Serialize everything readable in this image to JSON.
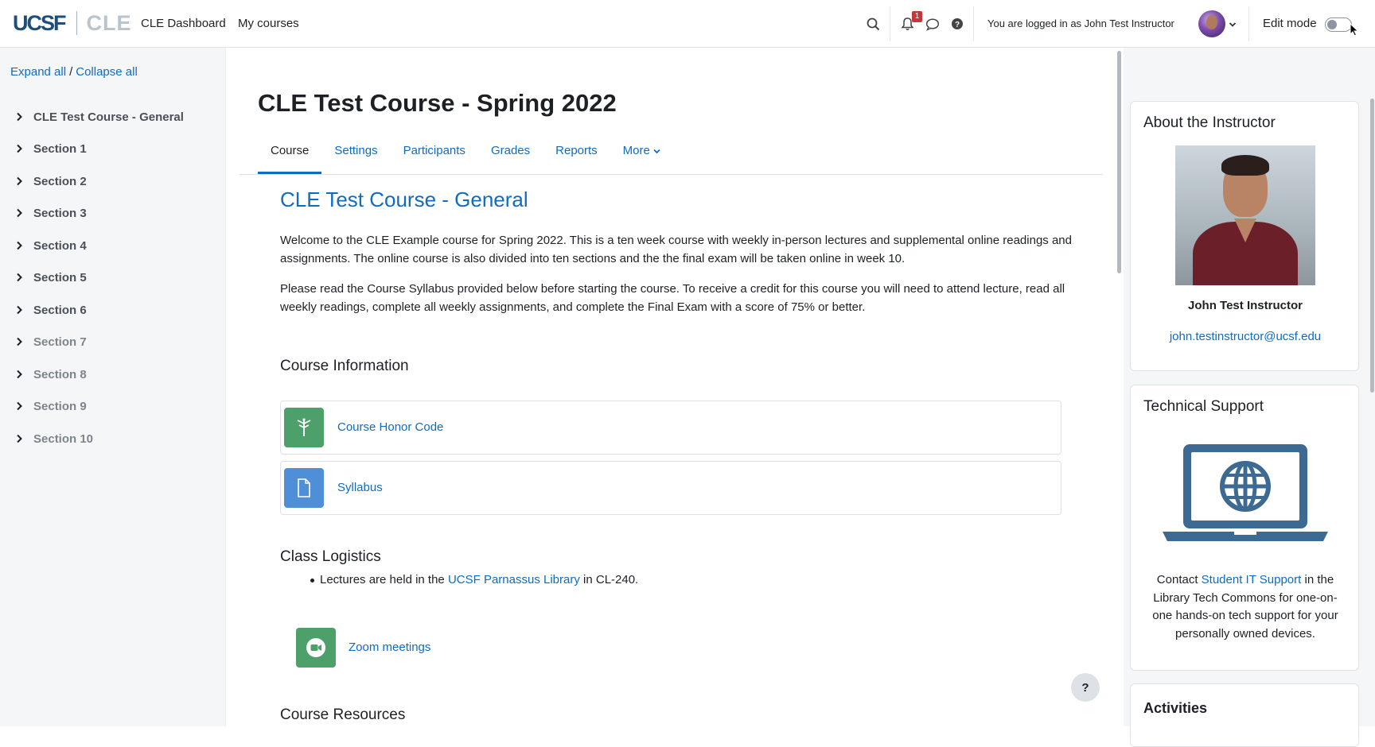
{
  "navbar": {
    "logo_ucsf": "UCSF",
    "logo_cle": "CLE",
    "links": [
      "CLE Dashboard",
      "My courses"
    ],
    "notification_count": "1",
    "login_text": "You are logged in as John Test Instructor",
    "edit_mode_label": "Edit mode",
    "edit_mode_on": false
  },
  "course_index": {
    "expand_all": "Expand all",
    "separator": "/",
    "collapse_all": "Collapse all",
    "items": [
      "CLE Test Course - General",
      "Section 1",
      "Section 2",
      "Section 3",
      "Section 4",
      "Section 5",
      "Section 6",
      "Section 7",
      "Section 8",
      "Section 9",
      "Section 10"
    ]
  },
  "main": {
    "page_title": "CLE Test Course - Spring 2022",
    "tabs": [
      "Course",
      "Settings",
      "Participants",
      "Grades",
      "Reports",
      "More"
    ],
    "active_tab": "Course",
    "section_title": "CLE Test Course - General",
    "para1": "Welcome to the CLE Example course for Spring 2022. This is a ten week course with weekly in-person lectures and supplemental online readings and assignments. The online course is also divided into ten sections and the the final exam will be taken online in week 10.",
    "para2": "Please read the Course Syllabus provided below before starting the course. To receive a credit for this course you will need to attend lecture, read all weekly readings, complete all weekly assignments, and complete the Final Exam with a score of 75% or better.",
    "course_info_heading": "Course Information",
    "activities": [
      {
        "name": "Course Honor Code",
        "icon": "signpost-icon",
        "color": "#4ea06a"
      },
      {
        "name": "Syllabus",
        "icon": "file-icon",
        "color": "#4f8fd8"
      }
    ],
    "logistics_heading": "Class Logistics",
    "logistics_prefix": "Lectures are held in the",
    "logistics_link": "UCSF Parnassus Library",
    "logistics_suffix": "in CL-240.",
    "zoom_name": "Zoom meetings",
    "resources_heading": "Course Resources",
    "help_label": "?"
  },
  "right_blocks": {
    "instructor": {
      "title": "About the Instructor",
      "name": "John Test Instructor",
      "email": "john.testinstructor@ucsf.edu"
    },
    "support": {
      "title": "Technical Support",
      "prefix": "Contact",
      "link": "Student IT Support",
      "suffix": "in the Library Tech Commons for one-on-one hands-on tech support for your personally owned devices."
    },
    "activities_title": "Activities"
  },
  "colors": {
    "link": "#0f6cbf",
    "drawer_bg": "#f5f6f8",
    "laptop": "#3d6a93"
  }
}
